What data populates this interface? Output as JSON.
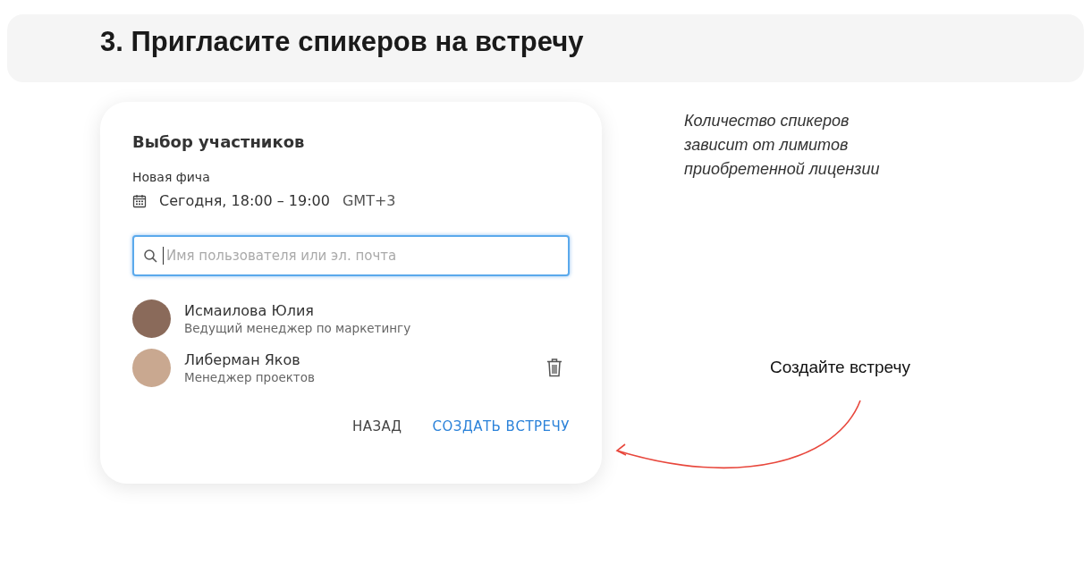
{
  "header": {
    "title": "3. Пригласите спикеров на встречу"
  },
  "dialog": {
    "title": "Выбор участников",
    "event_name": "Новая фича",
    "time": "Сегодня, 18:00 – 19:00",
    "timezone": "GMT+3",
    "search": {
      "placeholder": "Имя пользователя или эл. почта",
      "focused": true
    },
    "participants": [
      {
        "name": "Исмаилова Юлия",
        "role": "Ведущий менеджер по маркетингу",
        "deletable": false
      },
      {
        "name": "Либерман Яков",
        "role": "Менеджер проектов",
        "deletable": true
      }
    ],
    "buttons": [
      {
        "label": "НАЗАД",
        "kind": "secondary"
      },
      {
        "label": "СОЗДАТЬ ВСТРЕЧУ",
        "kind": "primary"
      }
    ]
  },
  "note": "Количество спикеров зависит от лимитов приобретенной лицензии",
  "callout": "Создайте встречу"
}
